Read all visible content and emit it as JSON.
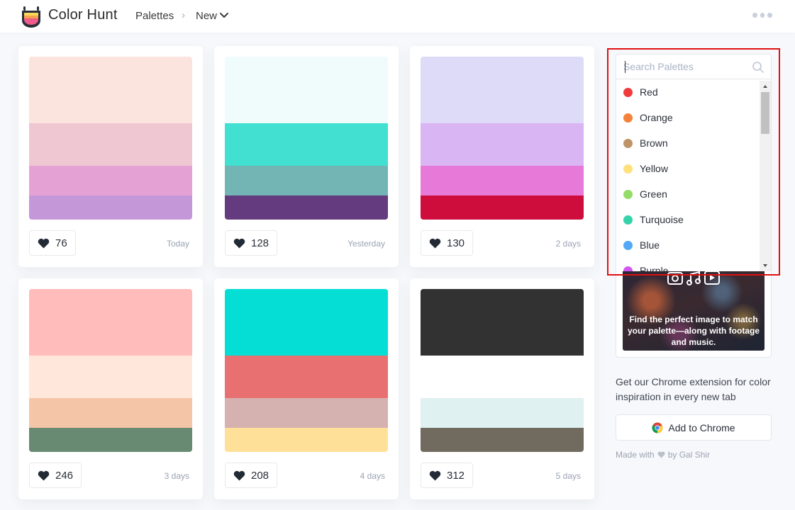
{
  "header": {
    "brand": "Color Hunt",
    "nav_palettes": "Palettes",
    "nav_separator": "›",
    "nav_current": "New",
    "more_icon": "more-icon"
  },
  "palettes": [
    {
      "colors": [
        "#FCE4DE",
        "#EEC7D2",
        "#E4A2D4",
        "#C397D8"
      ],
      "likes": "76",
      "age": "Today"
    },
    {
      "colors": [
        "#F0FCFC",
        "#41E0D0",
        "#73B4B5",
        "#633B7E"
      ],
      "likes": "128",
      "age": "Yesterday"
    },
    {
      "colors": [
        "#DDDBF7",
        "#DAB5F3",
        "#E779D9",
        "#CF0D3C"
      ],
      "likes": "130",
      "age": "2 days"
    },
    {
      "colors": [
        "#FFBCBA",
        "#FFE8DB",
        "#F5C5A7",
        "#688A72"
      ],
      "likes": "246",
      "age": "3 days"
    },
    {
      "colors": [
        "#04DED5",
        "#E87070",
        "#D5B2B0",
        "#FFE098"
      ],
      "likes": "208",
      "age": "4 days"
    },
    {
      "colors": [
        "#323232",
        "#FFFFFF",
        "#DFF1F0",
        "#716A5E"
      ],
      "likes": "312",
      "age": "5 days"
    }
  ],
  "search": {
    "placeholder": "Search Palettes",
    "value": ""
  },
  "filters": [
    {
      "label": "Red",
      "color": "#F03B3B"
    },
    {
      "label": "Orange",
      "color": "#F5823B"
    },
    {
      "label": "Brown",
      "color": "#BE9467"
    },
    {
      "label": "Yellow",
      "color": "#FFE17C"
    },
    {
      "label": "Green",
      "color": "#94DB69"
    },
    {
      "label": "Turquoise",
      "color": "#35D3AA"
    },
    {
      "label": "Blue",
      "color": "#53A8F8"
    },
    {
      "label": "Purple",
      "color": "#D257F0"
    }
  ],
  "ad": {
    "text": "Find the perfect image to match your palette—along with footage and music."
  },
  "extension": {
    "text": "Get our Chrome extension for color inspiration in every new tab",
    "button_label": "Add to Chrome"
  },
  "credit": {
    "prefix": "Made with",
    "suffix": "by Gal Shir"
  }
}
